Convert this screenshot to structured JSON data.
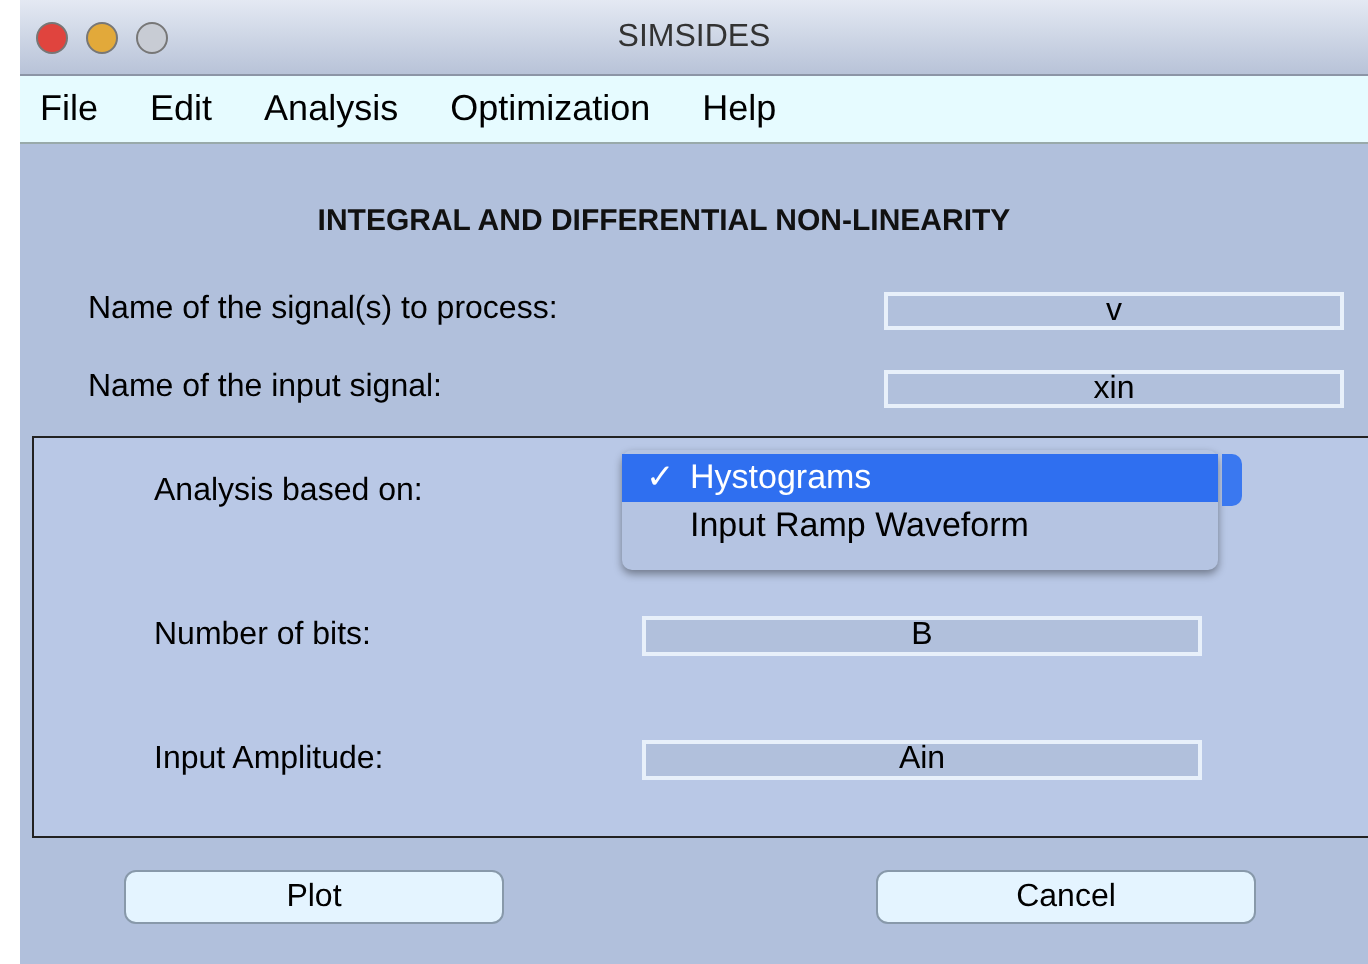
{
  "window": {
    "title": "SIMSIDES"
  },
  "menu": [
    "File",
    "Edit",
    "Analysis",
    "Optimization",
    "Help"
  ],
  "heading": "INTEGRAL AND DIFFERENTIAL NON-LINEARITY",
  "top_fields": [
    {
      "label": "Name of the signal(s) to process:",
      "value": "v"
    },
    {
      "label": "Name of the input signal:",
      "value": "xin"
    }
  ],
  "analysis": {
    "label": "Analysis based on:",
    "check_mark": "✓",
    "options": [
      {
        "label": "Hystograms",
        "selected": true,
        "checked": true
      },
      {
        "label": "Input Ramp Waveform",
        "selected": false,
        "checked": false
      }
    ]
  },
  "box_fields": [
    {
      "label": "Number of bits:",
      "value": "B"
    },
    {
      "label": "Input Amplitude:",
      "value": "Ain"
    }
  ],
  "buttons": [
    "Plot",
    "Cancel"
  ]
}
